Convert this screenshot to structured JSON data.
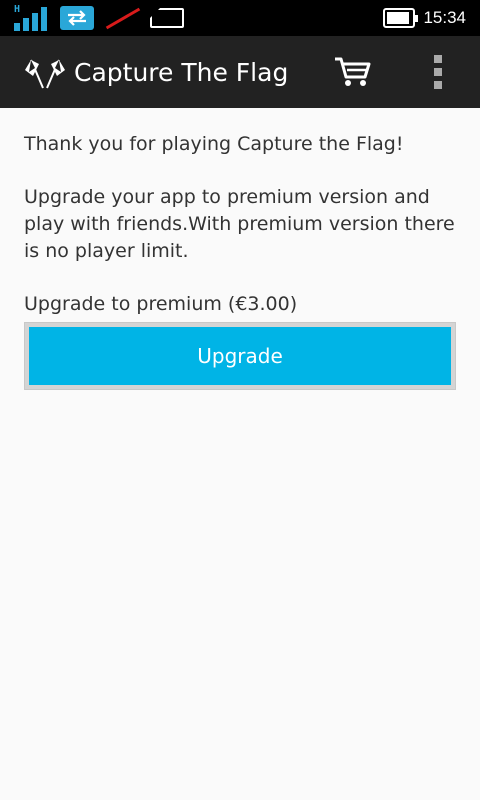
{
  "status_bar": {
    "network_type": "H",
    "time": "15:34",
    "icons": [
      "signal-icon",
      "data-transfer-icon",
      "no-sim-icon",
      "sim-card-icon",
      "battery-icon"
    ]
  },
  "action_bar": {
    "title": "Capture The Flag",
    "logo_icon": "checkered-flags-icon",
    "cart_icon": "shopping-cart-icon",
    "overflow_icon": "overflow-menu-icon"
  },
  "content": {
    "thanks_text": "Thank you for playing Capture the Flag!",
    "description": "Upgrade your app to premium version and play with friends.With premium version there is no player limit.",
    "price_label": "Upgrade to premium (€3.00)",
    "upgrade_button_label": "Upgrade"
  },
  "colors": {
    "accent": "#00b4e6",
    "action_bar": "#222222",
    "status_bar": "#000000",
    "background": "#fafafa",
    "status_icons": "#2aa7d8",
    "no_sim_slash": "#d81b1b"
  }
}
